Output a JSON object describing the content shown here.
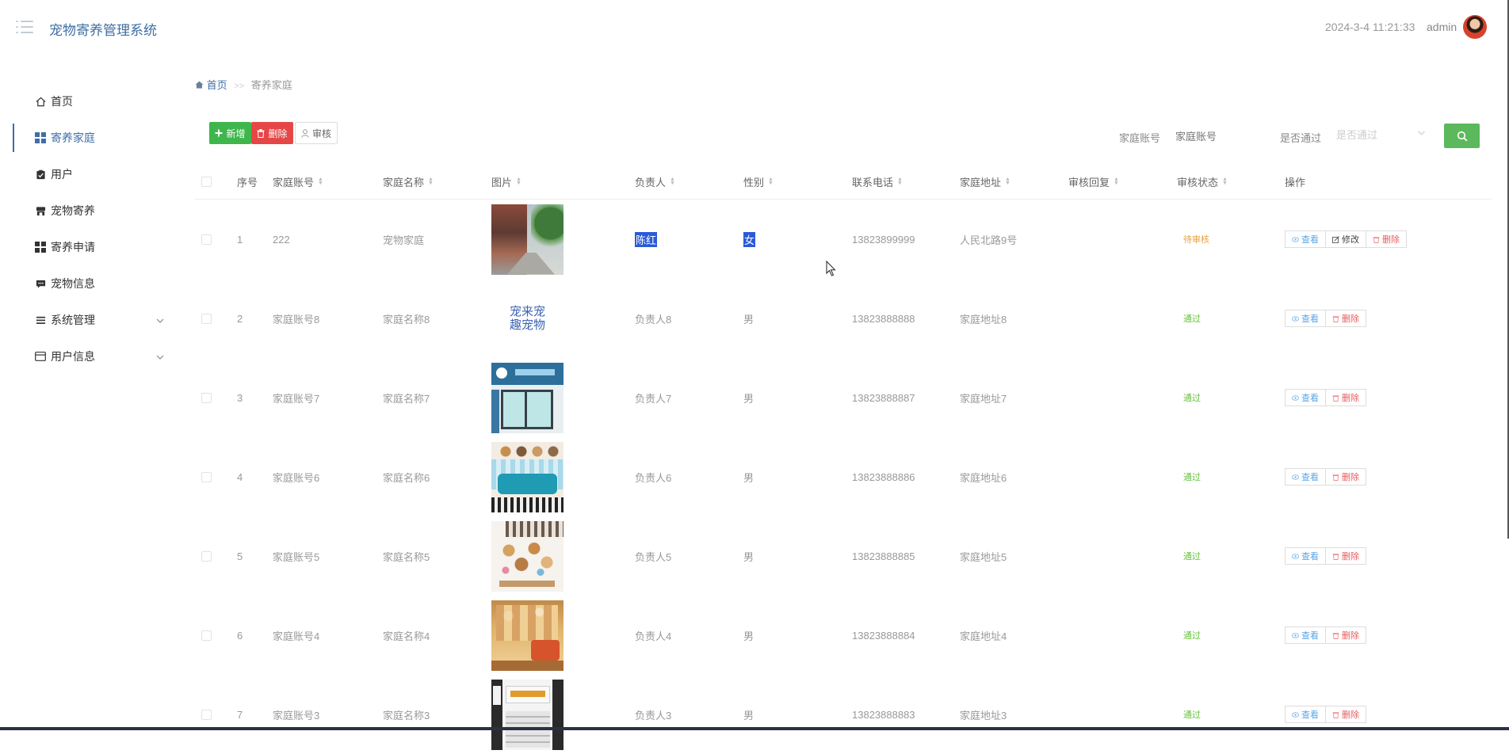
{
  "header": {
    "title": "宠物寄养管理系统",
    "datetime": "2024-3-4 11:21:33",
    "username": "admin"
  },
  "sidebar": {
    "items": [
      {
        "label": "首页",
        "icon": "home-icon"
      },
      {
        "label": "寄养家庭",
        "icon": "grid-icon",
        "active": true
      },
      {
        "label": "用户",
        "icon": "clipboard-icon"
      },
      {
        "label": "宠物寄养",
        "icon": "store-icon"
      },
      {
        "label": "寄养申请",
        "icon": "grid-icon"
      },
      {
        "label": "宠物信息",
        "icon": "chat-icon"
      },
      {
        "label": "系统管理",
        "icon": "list-icon",
        "expandable": true
      },
      {
        "label": "用户信息",
        "icon": "card-icon",
        "expandable": true
      }
    ]
  },
  "breadcrumb": {
    "home": "首页",
    "separator": ">>",
    "current": "寄养家庭"
  },
  "toolbar": {
    "add_label": "新增",
    "delete_label": "删除",
    "audit_label": "审核"
  },
  "filters": {
    "account_label": "家庭账号",
    "account_placeholder": "家庭账号",
    "approved_label": "是否通过",
    "approved_placeholder": "是否通过"
  },
  "table": {
    "columns": [
      "序号",
      "家庭账号",
      "家庭名称",
      "图片",
      "负责人",
      "性别",
      "联系电话",
      "家庭地址",
      "审核回复",
      "审核状态",
      "操作"
    ],
    "rows": [
      {
        "index": "1",
        "account": "222",
        "name": "宠物家庭",
        "image": "street-photo",
        "manager": "陈红",
        "gender": "女",
        "phone": "13823899999",
        "address": "人民北路9号",
        "reply": "",
        "status": "待审核",
        "actions": [
          "查看",
          "修改",
          "删除"
        ]
      },
      {
        "index": "2",
        "account": "家庭账号8",
        "name": "家庭名称8",
        "image": "logo-text",
        "image_text": "宠来宠趣宠物",
        "manager": "负责人8",
        "gender": "男",
        "phone": "13823888888",
        "address": "家庭地址8",
        "reply": "",
        "status": "通过",
        "actions": [
          "查看",
          "删除"
        ]
      },
      {
        "index": "3",
        "account": "家庭账号7",
        "name": "家庭名称7",
        "image": "storefront-photo",
        "manager": "负责人7",
        "gender": "男",
        "phone": "13823888887",
        "address": "家庭地址7",
        "reply": "",
        "status": "通过",
        "actions": [
          "查看",
          "删除"
        ]
      },
      {
        "index": "4",
        "account": "家庭账号6",
        "name": "家庭名称6",
        "image": "sofa-photo",
        "manager": "负责人6",
        "gender": "男",
        "phone": "13823888886",
        "address": "家庭地址6",
        "reply": "",
        "status": "通过",
        "actions": [
          "查看",
          "删除"
        ]
      },
      {
        "index": "5",
        "account": "家庭账号5",
        "name": "家庭名称5",
        "image": "dogs-wall-photo",
        "manager": "负责人5",
        "gender": "男",
        "phone": "13823888885",
        "address": "家庭地址5",
        "reply": "",
        "status": "通过",
        "actions": [
          "查看",
          "删除"
        ]
      },
      {
        "index": "6",
        "account": "家庭账号4",
        "name": "家庭名称4",
        "image": "interior-photo",
        "manager": "负责人4",
        "gender": "男",
        "phone": "13823888884",
        "address": "家庭地址4",
        "reply": "",
        "status": "通过",
        "actions": [
          "查看",
          "删除"
        ]
      },
      {
        "index": "7",
        "account": "家庭账号3",
        "name": "家庭名称3",
        "image": "shop-sign-photo",
        "manager": "负责人3",
        "gender": "男",
        "phone": "13823888883",
        "address": "家庭地址3",
        "reply": "",
        "status": "通过",
        "actions": [
          "查看",
          "删除"
        ]
      }
    ]
  },
  "colors": {
    "primary": "#3f6ea8",
    "add_button": "#3fb64b",
    "delete_button": "#e64646",
    "search_button": "#5cb85c",
    "pending": "#e6a23c",
    "approved": "#67c23a"
  }
}
